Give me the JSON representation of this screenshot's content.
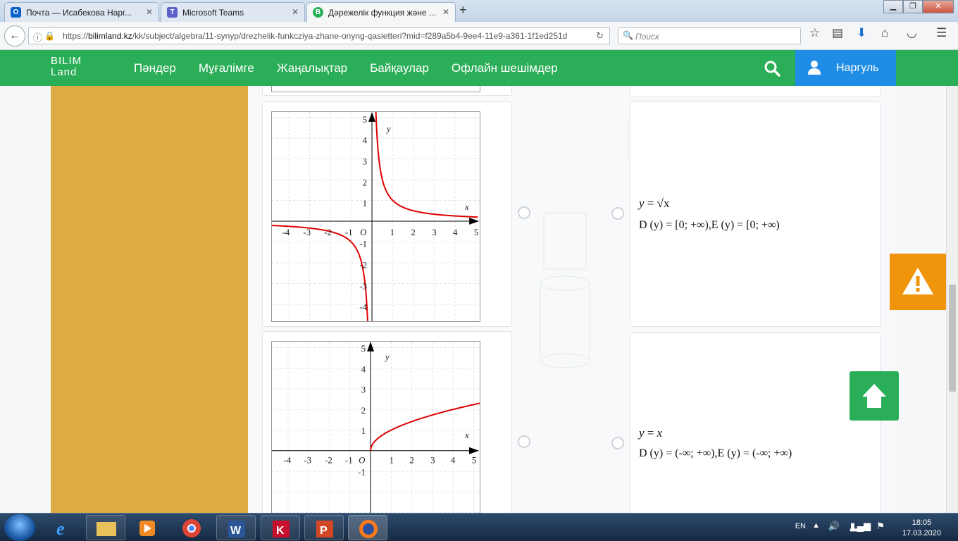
{
  "browser": {
    "tabs": [
      {
        "label": "Почта — Исабекова Нарг...",
        "active": false
      },
      {
        "label": "Microsoft Teams",
        "active": false
      },
      {
        "label": "Дәрежелік функция және ...",
        "active": true
      }
    ],
    "url": {
      "prefix": "https://",
      "domain": "bilimland.kz",
      "path": "/kk/subject/algebra/11-synyp/drezhelik-funkcziya-zhane-onyng-qasietteri?mid=f289a5b4-9ee4-11e9-a361-1f1ed251d"
    },
    "search_placeholder": "Поиск"
  },
  "site": {
    "logo_line1": "BILIM",
    "logo_line2": "Land",
    "menu": [
      "Пәндер",
      "Мұғалімге",
      "Жаңалықтар",
      "Байқаулар",
      "Офлайн шешімдер"
    ],
    "user_name": "Наргуль",
    "colors": {
      "header_green": "#2aae57",
      "user_blue": "#1f8de6",
      "side_gold": "#dcac43",
      "warn_orange": "#f0950b",
      "curve_red": "#e00000"
    }
  },
  "graph1": {
    "x_label": "x",
    "y_label": "y",
    "origin": "O",
    "x_ticks": [
      "-4",
      "-3",
      "-2",
      "-1",
      "1",
      "2",
      "3",
      "4",
      "5"
    ],
    "y_ticks": [
      "5",
      "4",
      "3",
      "2",
      "1",
      "-1",
      "-2",
      "-3",
      "-4"
    ],
    "function": "reciprocal"
  },
  "graph2": {
    "x_label": "x",
    "y_label": "y",
    "origin": "O",
    "x_ticks": [
      "-4",
      "-3",
      "-2",
      "-1",
      "1",
      "2",
      "3",
      "4",
      "5"
    ],
    "y_ticks": [
      "5",
      "4",
      "3",
      "2",
      "1",
      "-1"
    ],
    "function": "sqrt"
  },
  "answers": [
    {
      "func_lhs": "y",
      "func_rhs": "√x",
      "domain": "D (y) = [0; +∞),",
      "range": "E (y) = [0; +∞)"
    },
    {
      "func_lhs": "y",
      "func_rhs": "x",
      "domain": "D (y) = (-∞; +∞),",
      "range": "E (y) = (-∞; +∞)"
    }
  ],
  "taskbar": {
    "lang": "EN",
    "time": "18:05",
    "date": "17.03.2020"
  }
}
